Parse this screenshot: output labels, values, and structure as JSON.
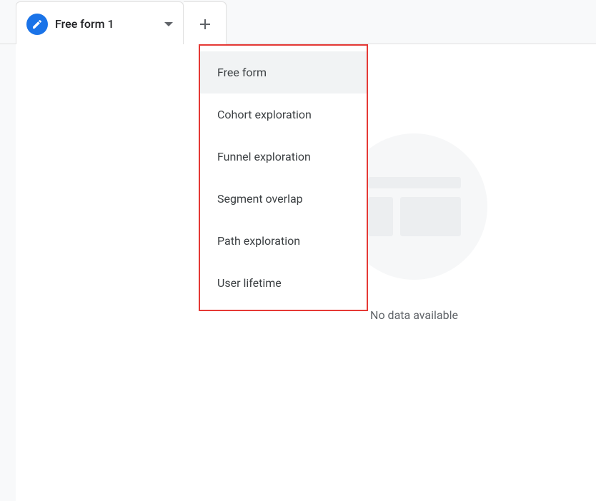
{
  "tab": {
    "label": "Free form 1"
  },
  "menu": {
    "items": [
      {
        "label": "Free form"
      },
      {
        "label": "Cohort exploration"
      },
      {
        "label": "Funnel exploration"
      },
      {
        "label": "Segment overlap"
      },
      {
        "label": "Path exploration"
      },
      {
        "label": "User lifetime"
      }
    ]
  },
  "emptyState": {
    "message": "No data available"
  }
}
